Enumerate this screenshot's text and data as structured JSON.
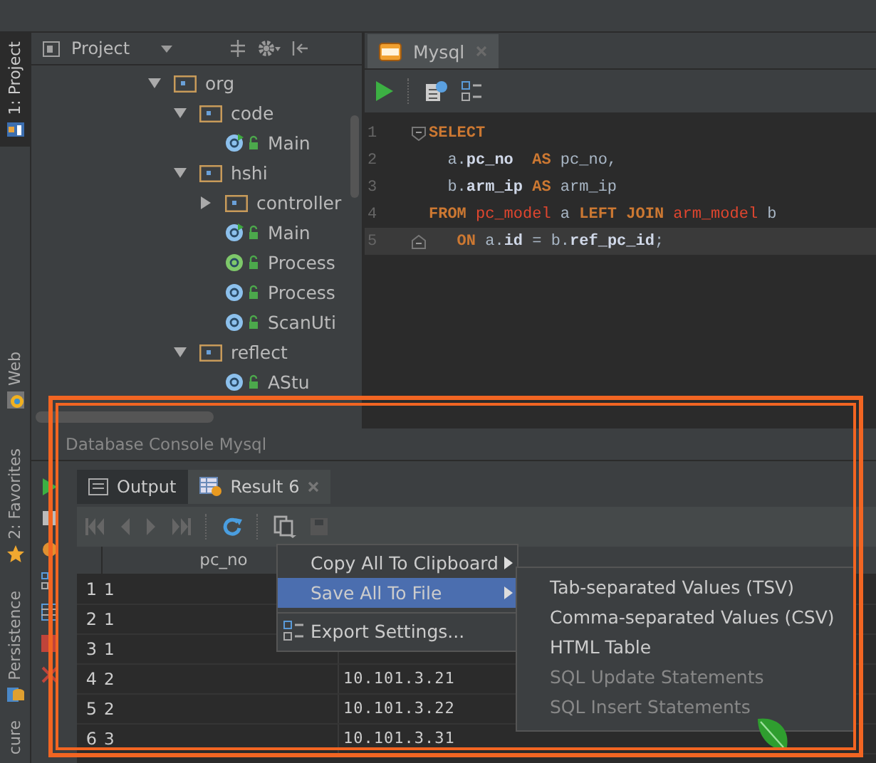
{
  "side_tabs": [
    {
      "label": "1: Project",
      "selected": true
    },
    {
      "label": "Web",
      "selected": false
    },
    {
      "label": "2: Favorites",
      "selected": false
    },
    {
      "label": "Persistence",
      "selected": false
    },
    {
      "label": "cure",
      "selected": false
    }
  ],
  "project_panel": {
    "title": "Project",
    "tree": [
      {
        "label": "org",
        "kind": "package",
        "expanded": true,
        "children": [
          {
            "label": "code",
            "kind": "package",
            "expanded": true,
            "children": [
              {
                "label": "Main",
                "kind": "class",
                "runnable": true
              }
            ]
          },
          {
            "label": "hshi",
            "kind": "package",
            "expanded": true,
            "children": [
              {
                "label": "controller",
                "kind": "package",
                "expanded": false
              },
              {
                "label": "Main",
                "kind": "class",
                "runnable": true
              },
              {
                "label": "Process",
                "kind": "interface",
                "runnable": false
              },
              {
                "label": "Process",
                "kind": "class",
                "runnable": false
              },
              {
                "label": "ScanUti",
                "kind": "class",
                "runnable": false
              }
            ]
          },
          {
            "label": "reflect",
            "kind": "package",
            "expanded": true,
            "children": [
              {
                "label": "AStu",
                "kind": "class",
                "runnable": false
              }
            ]
          }
        ]
      }
    ]
  },
  "editor": {
    "tabs": [
      {
        "label": "Mysql",
        "selected": true
      }
    ],
    "lines": [
      {
        "number": "1",
        "current": false,
        "tokens": [
          {
            "text": "SELECT",
            "kind": "keyword"
          }
        ]
      },
      {
        "number": "2",
        "current": false,
        "tokens": [
          {
            "text": "  a.",
            "kind": "plain"
          },
          {
            "text": "pc_no",
            "kind": "field"
          },
          {
            "text": "  AS",
            "kind": "keyword"
          },
          {
            "text": " pc_no,",
            "kind": "plain"
          }
        ]
      },
      {
        "number": "3",
        "current": false,
        "tokens": [
          {
            "text": "  b.",
            "kind": "plain"
          },
          {
            "text": "arm_ip",
            "kind": "field"
          },
          {
            "text": " AS",
            "kind": "keyword"
          },
          {
            "text": " arm_ip",
            "kind": "plain"
          }
        ]
      },
      {
        "number": "4",
        "current": false,
        "tokens": [
          {
            "text": "FROM",
            "kind": "keyword"
          },
          {
            "text": " pc_model",
            "kind": "table"
          },
          {
            "text": " a",
            "kind": "plain"
          },
          {
            "text": " LEFT JOIN",
            "kind": "keyword"
          },
          {
            "text": " arm_model",
            "kind": "table"
          },
          {
            "text": " b",
            "kind": "plain"
          }
        ]
      },
      {
        "number": "5",
        "current": true,
        "tokens": [
          {
            "text": "   ON",
            "kind": "keyword"
          },
          {
            "text": " a.",
            "kind": "plain"
          },
          {
            "text": "id",
            "kind": "field"
          },
          {
            "text": " = b.",
            "kind": "plain"
          },
          {
            "text": "ref_pc_id",
            "kind": "field"
          },
          {
            "text": ";",
            "kind": "plain"
          }
        ]
      }
    ]
  },
  "console": {
    "title": "Database Console Mysql",
    "tabs": [
      {
        "label": "Output",
        "selected": false
      },
      {
        "label": "Result 6",
        "selected": true
      }
    ],
    "table": {
      "columns": [
        "pc_no"
      ],
      "rows": [
        {
          "number": "1",
          "pc_no": "1"
        },
        {
          "number": "2",
          "pc_no": "1"
        },
        {
          "number": "3",
          "pc_no": "1"
        },
        {
          "number": "4",
          "pc_no": "2",
          "ip": "10.101.3.21"
        },
        {
          "number": "5",
          "pc_no": "2",
          "ip": "10.101.3.22"
        },
        {
          "number": "6",
          "pc_no": "3",
          "ip": "10.101.3.31"
        }
      ]
    }
  },
  "context_menu": {
    "items": [
      {
        "label": "Copy All To Clipboard",
        "kind": "submenu",
        "selected": false
      },
      {
        "label": "Save All To File",
        "kind": "submenu",
        "selected": true
      },
      {
        "label": "Export Settings...",
        "kind": "action",
        "selected": false
      }
    ]
  },
  "submenu": {
    "items": [
      {
        "label": "Tab-separated Values (TSV)",
        "disabled": false
      },
      {
        "label": "Comma-separated Values (CSV)",
        "disabled": false
      },
      {
        "label": "HTML Table",
        "disabled": false
      },
      {
        "label": "SQL Update Statements",
        "disabled": true
      },
      {
        "label": "SQL Insert Statements",
        "disabled": true
      }
    ]
  }
}
